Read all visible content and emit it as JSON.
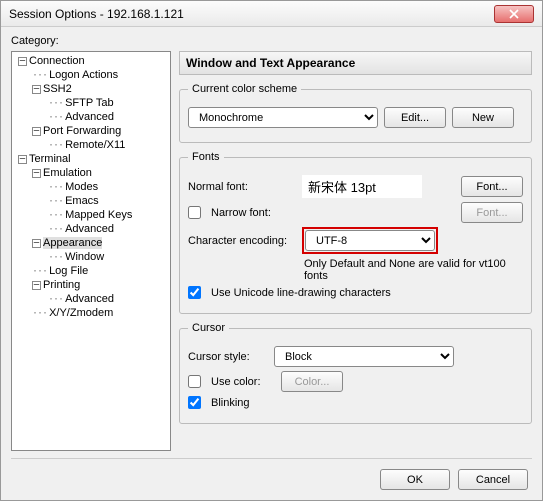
{
  "title": "Session Options - 192.168.1.121",
  "category_label": "Category:",
  "tree": {
    "connection": "Connection",
    "logon_actions": "Logon Actions",
    "ssh2": "SSH2",
    "sftp_tab": "SFTP Tab",
    "advanced": "Advanced",
    "port_forwarding": "Port Forwarding",
    "remote_x11": "Remote/X11",
    "terminal": "Terminal",
    "emulation": "Emulation",
    "modes": "Modes",
    "emacs": "Emacs",
    "mapped_keys": "Mapped Keys",
    "advanced2": "Advanced",
    "appearance": "Appearance",
    "window": "Window",
    "log_file": "Log File",
    "printing": "Printing",
    "advanced3": "Advanced",
    "xyzmodem": "X/Y/Zmodem"
  },
  "panel_title": "Window and Text Appearance",
  "scheme": {
    "legend": "Current color scheme",
    "value": "Monochrome",
    "edit": "Edit...",
    "new": "New"
  },
  "fonts": {
    "legend": "Fonts",
    "normal_label": "Normal font:",
    "normal_value": "新宋体 13pt",
    "font_btn": "Font...",
    "narrow_label": "Narrow font:",
    "font_btn2": "Font...",
    "enc_label": "Character encoding:",
    "enc_value": "UTF-8",
    "note": "Only Default and None are valid for vt100 fonts",
    "unicode_label": "Use Unicode line-drawing characters"
  },
  "cursor": {
    "legend": "Cursor",
    "style_label": "Cursor style:",
    "style_value": "Block",
    "use_color_label": "Use color:",
    "color_btn": "Color...",
    "blinking_label": "Blinking"
  },
  "footer": {
    "ok": "OK",
    "cancel": "Cancel"
  }
}
